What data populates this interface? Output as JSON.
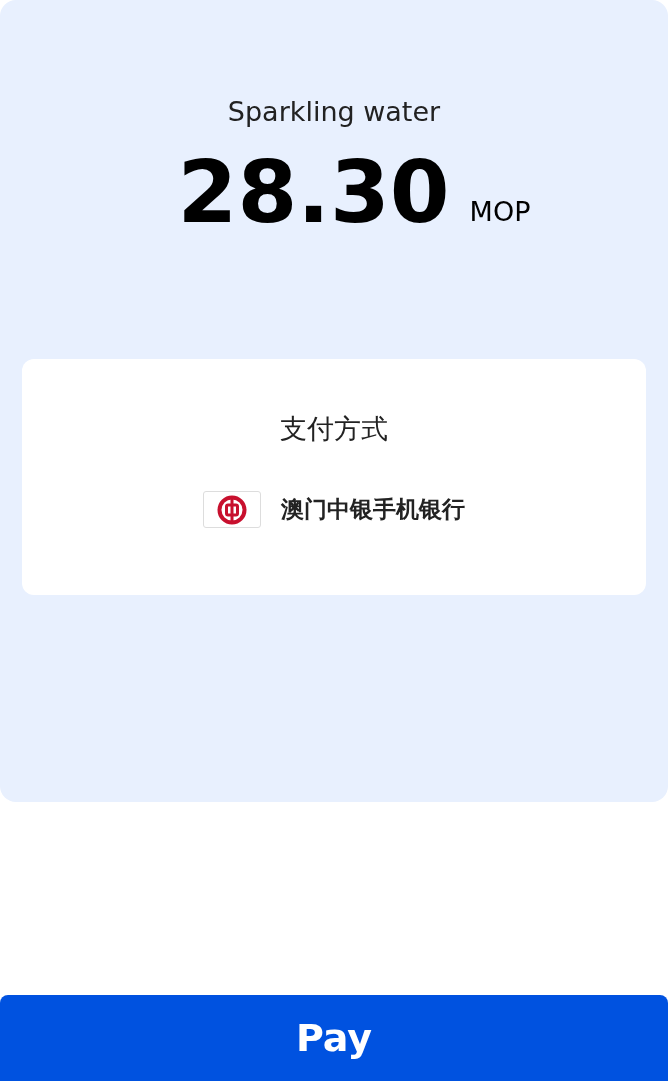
{
  "product": {
    "name": "Sparkling water",
    "amount": "28.30",
    "currency": "MOP"
  },
  "payment": {
    "title": "支付方式",
    "method": "澳门中银手机银行"
  },
  "pay_button": {
    "label": "Pay"
  }
}
